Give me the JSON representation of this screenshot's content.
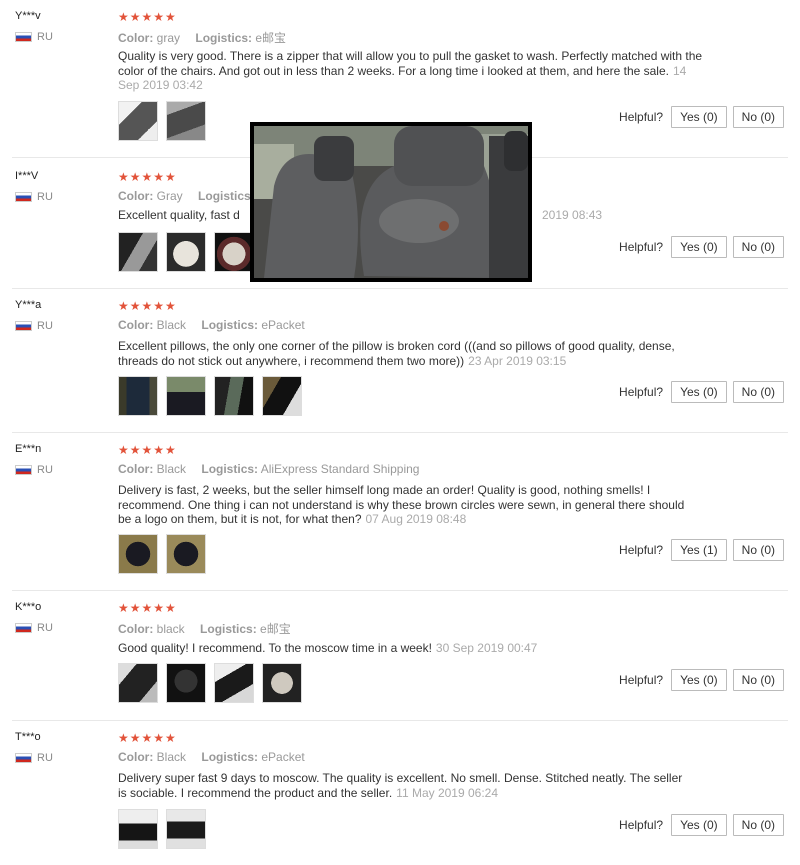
{
  "helpful_label": "Helpful?",
  "labels": {
    "color": "Color:",
    "logistics": "Logistics:"
  },
  "reviews": [
    {
      "user": "Y***v",
      "country": "RU",
      "stars": "★★★★★",
      "color": "gray",
      "logistics": "e邮宝",
      "text": "Quality is very good. There is a zipper that will allow you to pull the gasket to wash. Perfectly matched with the color of the chairs. And got out in less than 2 weeks. For a long time i looked at them, and here the sale.",
      "date": "14 Sep 2019 03:42",
      "yes": "Yes (0)",
      "no": "No (0)"
    },
    {
      "user": "I***V",
      "country": "RU",
      "stars": "★★★★★",
      "color": "Gray",
      "logistics": "",
      "text": "Excellent quality, fast d",
      "date": "2019 08:43",
      "yes": "Yes (0)",
      "no": "No (0)"
    },
    {
      "user": "Y***a",
      "country": "RU",
      "stars": "★★★★★",
      "color": "Black",
      "logistics": "ePacket",
      "text": "Excellent pillows, the only one corner of the pillow is broken cord (((and so pillows of good quality, dense, threads do not stick out anywhere, i recommend them two more))",
      "date": "23 Apr 2019 03:15",
      "yes": "Yes (0)",
      "no": "No (0)"
    },
    {
      "user": "E***n",
      "country": "RU",
      "stars": "★★★★★",
      "color": "Black",
      "logistics": "AliExpress Standard Shipping",
      "text": "Delivery is fast, 2 weeks, but the seller himself long made an order! Quality is good, nothing smells! I recommend. One thing i can not understand is why these brown circles were sewn, in general there should be a logo on them, but it is not, for what then?",
      "date": "07 Aug 2019 08:48",
      "yes": "Yes (1)",
      "no": "No (0)"
    },
    {
      "user": "K***o",
      "country": "RU",
      "stars": "★★★★★",
      "color": "black",
      "logistics": "e邮宝",
      "text": "Good quality! I recommend. To the moscow time in a week!",
      "date": "30 Sep 2019 00:47",
      "yes": "Yes (0)",
      "no": "No (0)"
    },
    {
      "user": "T***o",
      "country": "RU",
      "stars": "★★★★★",
      "color": "Black",
      "logistics": "ePacket",
      "text": "Delivery super fast 9 days to moscow. The quality is excellent. No smell. Dense. Stitched neatly. The seller is sociable. I recommend the product and the seller.",
      "date": "11 May 2019 06:24",
      "yes": "Yes (0)",
      "no": "No (0)"
    }
  ]
}
